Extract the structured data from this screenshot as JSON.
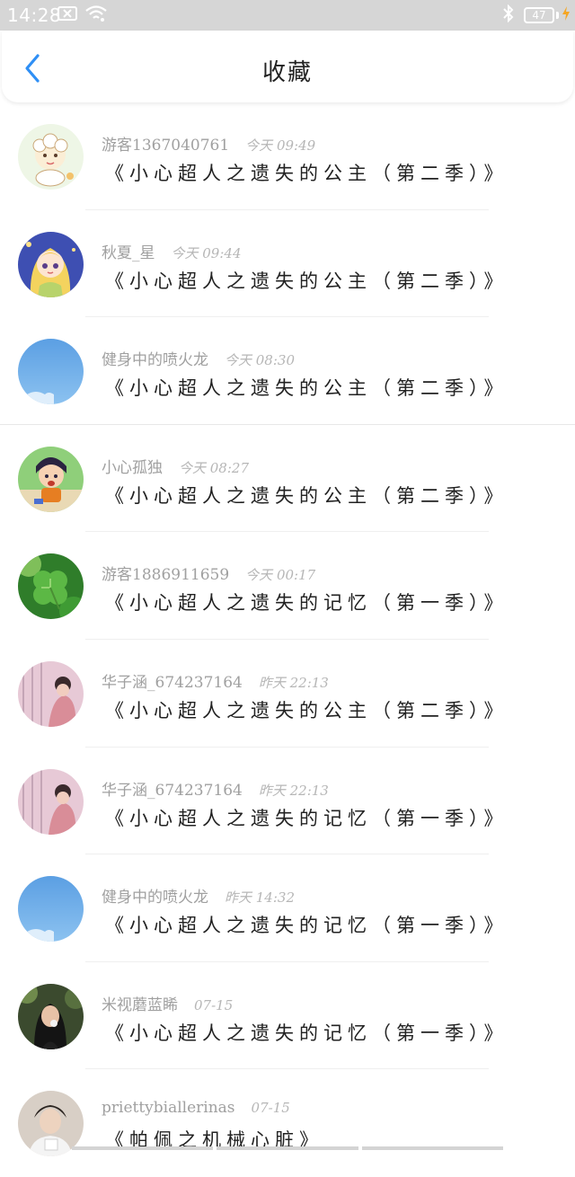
{
  "status_bar": {
    "time": "14:28",
    "battery": "47",
    "icons": [
      "close-notification-icon",
      "wifi-icon",
      "bluetooth-icon",
      "battery-icon",
      "charging-icon"
    ]
  },
  "header": {
    "title": "收藏",
    "back_icon": "back-chevron-icon",
    "accent_color": "#2f8ff5"
  },
  "favorites": [
    {
      "user": "游客1367040761",
      "time": "今天 09:49",
      "title": "《小心超人之遗失的公主（第二季）》",
      "avatar": "avatar-sheep-cartoon"
    },
    {
      "user": "秋夏_星",
      "time": "今天 09:44",
      "title": "《小心超人之遗失的公主（第二季）》",
      "avatar": "avatar-princess-cartoon"
    },
    {
      "user": "健身中的喷火龙",
      "time": "今天 08:30",
      "title": "《小心超人之遗失的公主（第二季）》",
      "avatar": "avatar-blue-sky"
    },
    {
      "user": "小心孤独",
      "time": "今天 08:27",
      "title": "《小心超人之遗失的公主（第二季）》",
      "avatar": "avatar-boy-cartoon"
    },
    {
      "user": "游客1886911659",
      "time": "今天 00:17",
      "title": "《小心超人之遗失的记忆（第一季）》",
      "avatar": "avatar-clover"
    },
    {
      "user": "华子涵_674237164",
      "time": "昨天 22:13",
      "title": "《小心超人之遗失的公主（第二季）》",
      "avatar": "avatar-pink-girl"
    },
    {
      "user": "华子涵_674237164",
      "time": "昨天 22:13",
      "title": "《小心超人之遗失的记忆（第一季）》",
      "avatar": "avatar-pink-girl"
    },
    {
      "user": "健身中的喷火龙",
      "time": "昨天 14:32",
      "title": "《小心超人之遗失的记忆（第一季）》",
      "avatar": "avatar-blue-sky"
    },
    {
      "user": "米视蘑蓝睎",
      "time": "07-15",
      "title": "《小心超人之遗失的记忆（第一季）》",
      "avatar": "avatar-girl-photo"
    },
    {
      "user": "priettybiallerinas",
      "time": "07-15",
      "title": "《帕佩之机械心脏》",
      "avatar": "avatar-boy-photo"
    }
  ]
}
